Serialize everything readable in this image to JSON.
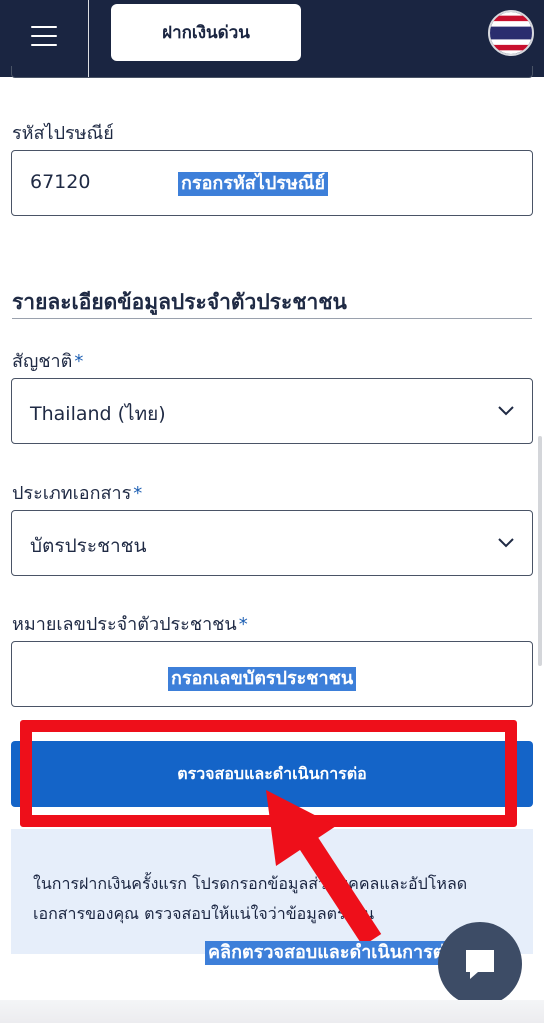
{
  "header": {
    "deposit_button": "ฝากเงินด่วน",
    "language_flag": "thai-flag-icon"
  },
  "postal": {
    "label": "รหัสไปรษณีย์",
    "value": "67120",
    "overlay": "กรอกรหัสไปรษณีย์"
  },
  "section": {
    "title": "รายละเอียดข้อมูลประจำตัวประชาชน"
  },
  "nationality": {
    "label": "สัญชาติ",
    "required": "*",
    "selected": "Thailand (ไทย)"
  },
  "doc_type": {
    "label": "ประเภทเอกสาร",
    "required": "*",
    "selected": "บัตรประชาชน"
  },
  "id_number": {
    "label": "หมายเลขประจำตัวประชาชน",
    "required": "*",
    "overlay": "กรอกเลขบัตรประชาชน"
  },
  "submit": {
    "label": "ตรวจสอบและดำเนินการต่อ"
  },
  "info": {
    "text": "ในการฝากเงินครั้งแรก โปรดกรอกข้อมูลส่วนบุคคลและอัปโหลดเอกสารของคุณ ตรวจสอบให้แน่ใจว่าข้อมูลตรงกัน"
  },
  "annotation": {
    "caption": "คลิกตรวจสอบและดำเนินการต่อ"
  },
  "colors": {
    "header_bg": "#1a2541",
    "primary": "#1464c8",
    "highlight": "#3d7fd9",
    "annotation_red": "#ee0f1a",
    "info_bg": "#e6eefa"
  }
}
